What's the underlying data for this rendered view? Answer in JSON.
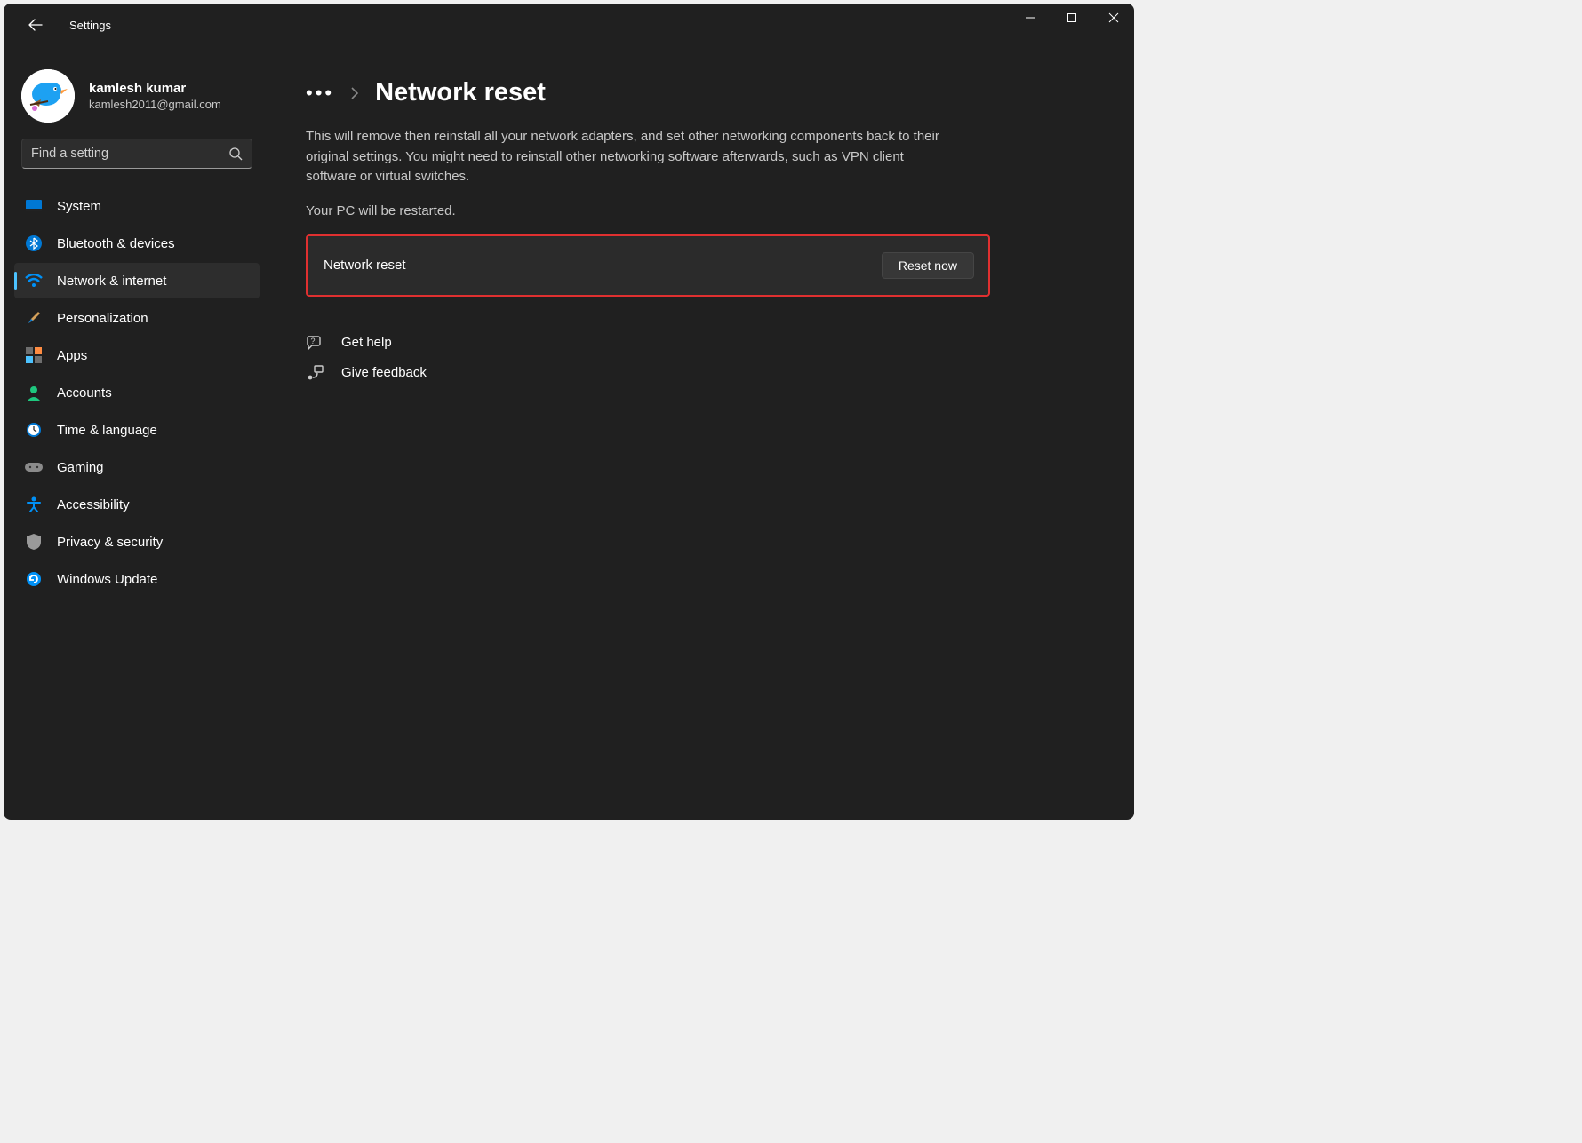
{
  "app_title": "Settings",
  "user": {
    "name": "kamlesh kumar",
    "email": "kamlesh2011@gmail.com"
  },
  "search": {
    "placeholder": "Find a setting"
  },
  "nav": [
    {
      "label": "System"
    },
    {
      "label": "Bluetooth & devices"
    },
    {
      "label": "Network & internet"
    },
    {
      "label": "Personalization"
    },
    {
      "label": "Apps"
    },
    {
      "label": "Accounts"
    },
    {
      "label": "Time & language"
    },
    {
      "label": "Gaming"
    },
    {
      "label": "Accessibility"
    },
    {
      "label": "Privacy & security"
    },
    {
      "label": "Windows Update"
    }
  ],
  "page": {
    "title": "Network reset",
    "description": "This will remove then reinstall all your network adapters, and set other networking components back to their original settings. You might need to reinstall other networking software afterwards, such as VPN client software or virtual switches.",
    "restart_note": "Your PC will be restarted.",
    "card_label": "Network reset",
    "reset_button": "Reset now"
  },
  "help": {
    "get_help": "Get help",
    "feedback": "Give feedback"
  }
}
